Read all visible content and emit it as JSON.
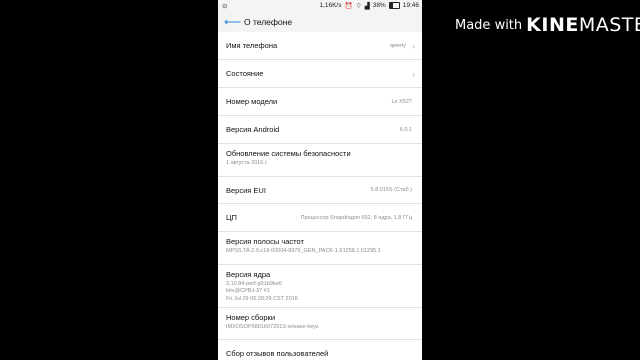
{
  "watermark": {
    "made_with": "Made with",
    "brand_bold": "KINE",
    "brand_rest": "MASTER"
  },
  "status_bar": {
    "left_icon": "⊙",
    "speed": "1,16K/s",
    "battery_pct": "38%",
    "time": "19:46"
  },
  "header": {
    "title": "О телефоне"
  },
  "rows": [
    {
      "label": "Имя телефона",
      "value": "qwerty"
    },
    {
      "label": "Состояние",
      "value": ""
    },
    {
      "label": "Номер модели",
      "value": "Le X527"
    },
    {
      "label": "Версия Android",
      "value": "6.0.1"
    },
    {
      "label": "Обновление системы безопасности",
      "sub": "1 августа 2016 г."
    },
    {
      "label": "Версия EUI",
      "value": "5.8.016S (Стаб.)"
    },
    {
      "label": "ЦП",
      "value": "Процессор Snapdragon 652, 8 ядра, 1,8 ГГц"
    },
    {
      "label": "Версия полосы частот",
      "sub": "MPSS.TA.2.0.c18-00004-8976_GEN_PACK-1.61258.1.61295.1"
    },
    {
      "label": "Версия ядра",
      "sub_lines": [
        "3.10.84-perf-g91b9be6",
        "letv@CPBJ-37 #1",
        "Fri Jul 29 05:28:29 CST 2016"
      ]
    },
    {
      "label": "Номер сборки",
      "sub": "IMXOSOP5801607291S release-keys"
    },
    {
      "label": "Сбор отзывов пользователей"
    }
  ]
}
